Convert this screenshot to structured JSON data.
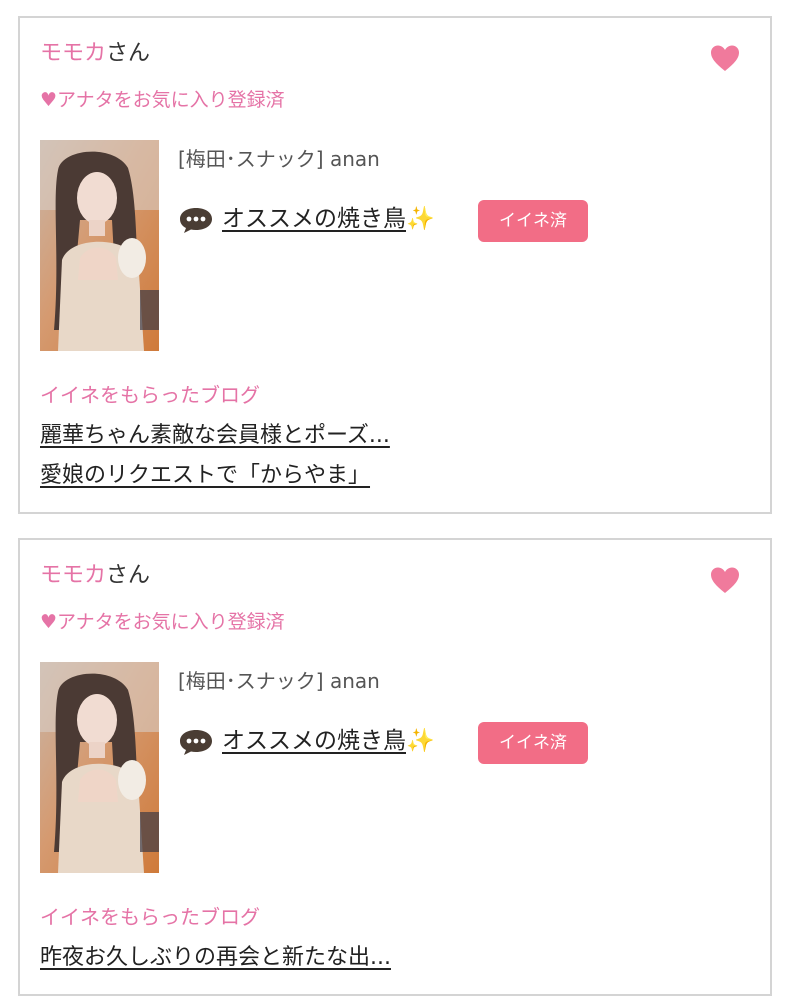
{
  "colors": {
    "accent_pink": "#e573a6",
    "badge_pink": "#f26d86",
    "heart_pink": "#f07a9c",
    "border": "#d4d4d4"
  },
  "cards": [
    {
      "user_name": "モモカ",
      "user_suffix": "さん",
      "heart_icon": "heart-icon",
      "favorite_status": "♥アナタをお気に入り登録済",
      "shop_label": "[梅田･スナック]  anan",
      "post_icon": "speech-bubble-icon",
      "post_title": "オススメの焼き鳥",
      "post_sparkle": "✨",
      "badge": "イイネ済",
      "blog_heading": "イイネをもらったブログ",
      "blogs": [
        "麗華ちゃん素敵な会員様とポーズ...",
        "愛娘のリクエストで「からやま」"
      ]
    },
    {
      "user_name": "モモカ",
      "user_suffix": "さん",
      "heart_icon": "heart-icon",
      "favorite_status": "♥アナタをお気に入り登録済",
      "shop_label": "[梅田･スナック]  anan",
      "post_icon": "speech-bubble-icon",
      "post_title": "オススメの焼き鳥",
      "post_sparkle": "✨",
      "badge": "イイネ済",
      "blog_heading": "イイネをもらったブログ",
      "blogs": [
        "昨夜お久しぶりの再会と新たな出..."
      ]
    }
  ]
}
